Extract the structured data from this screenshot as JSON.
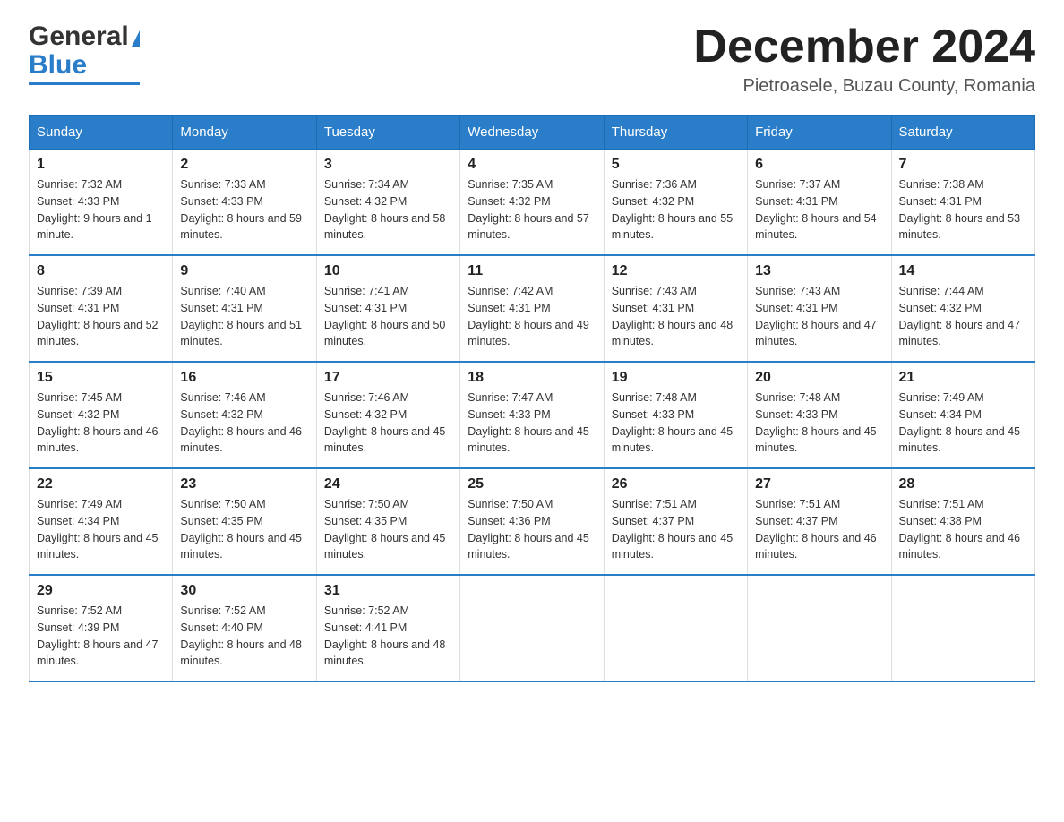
{
  "logo": {
    "general": "General",
    "blue": "Blue",
    "triangle": "▶"
  },
  "header": {
    "title": "December 2024",
    "subtitle": "Pietroasele, Buzau County, Romania"
  },
  "days_of_week": [
    "Sunday",
    "Monday",
    "Tuesday",
    "Wednesday",
    "Thursday",
    "Friday",
    "Saturday"
  ],
  "weeks": [
    [
      {
        "date": "1",
        "sunrise": "7:32 AM",
        "sunset": "4:33 PM",
        "daylight": "9 hours and 1 minute."
      },
      {
        "date": "2",
        "sunrise": "7:33 AM",
        "sunset": "4:33 PM",
        "daylight": "8 hours and 59 minutes."
      },
      {
        "date": "3",
        "sunrise": "7:34 AM",
        "sunset": "4:32 PM",
        "daylight": "8 hours and 58 minutes."
      },
      {
        "date": "4",
        "sunrise": "7:35 AM",
        "sunset": "4:32 PM",
        "daylight": "8 hours and 57 minutes."
      },
      {
        "date": "5",
        "sunrise": "7:36 AM",
        "sunset": "4:32 PM",
        "daylight": "8 hours and 55 minutes."
      },
      {
        "date": "6",
        "sunrise": "7:37 AM",
        "sunset": "4:31 PM",
        "daylight": "8 hours and 54 minutes."
      },
      {
        "date": "7",
        "sunrise": "7:38 AM",
        "sunset": "4:31 PM",
        "daylight": "8 hours and 53 minutes."
      }
    ],
    [
      {
        "date": "8",
        "sunrise": "7:39 AM",
        "sunset": "4:31 PM",
        "daylight": "8 hours and 52 minutes."
      },
      {
        "date": "9",
        "sunrise": "7:40 AM",
        "sunset": "4:31 PM",
        "daylight": "8 hours and 51 minutes."
      },
      {
        "date": "10",
        "sunrise": "7:41 AM",
        "sunset": "4:31 PM",
        "daylight": "8 hours and 50 minutes."
      },
      {
        "date": "11",
        "sunrise": "7:42 AM",
        "sunset": "4:31 PM",
        "daylight": "8 hours and 49 minutes."
      },
      {
        "date": "12",
        "sunrise": "7:43 AM",
        "sunset": "4:31 PM",
        "daylight": "8 hours and 48 minutes."
      },
      {
        "date": "13",
        "sunrise": "7:43 AM",
        "sunset": "4:31 PM",
        "daylight": "8 hours and 47 minutes."
      },
      {
        "date": "14",
        "sunrise": "7:44 AM",
        "sunset": "4:32 PM",
        "daylight": "8 hours and 47 minutes."
      }
    ],
    [
      {
        "date": "15",
        "sunrise": "7:45 AM",
        "sunset": "4:32 PM",
        "daylight": "8 hours and 46 minutes."
      },
      {
        "date": "16",
        "sunrise": "7:46 AM",
        "sunset": "4:32 PM",
        "daylight": "8 hours and 46 minutes."
      },
      {
        "date": "17",
        "sunrise": "7:46 AM",
        "sunset": "4:32 PM",
        "daylight": "8 hours and 45 minutes."
      },
      {
        "date": "18",
        "sunrise": "7:47 AM",
        "sunset": "4:33 PM",
        "daylight": "8 hours and 45 minutes."
      },
      {
        "date": "19",
        "sunrise": "7:48 AM",
        "sunset": "4:33 PM",
        "daylight": "8 hours and 45 minutes."
      },
      {
        "date": "20",
        "sunrise": "7:48 AM",
        "sunset": "4:33 PM",
        "daylight": "8 hours and 45 minutes."
      },
      {
        "date": "21",
        "sunrise": "7:49 AM",
        "sunset": "4:34 PM",
        "daylight": "8 hours and 45 minutes."
      }
    ],
    [
      {
        "date": "22",
        "sunrise": "7:49 AM",
        "sunset": "4:34 PM",
        "daylight": "8 hours and 45 minutes."
      },
      {
        "date": "23",
        "sunrise": "7:50 AM",
        "sunset": "4:35 PM",
        "daylight": "8 hours and 45 minutes."
      },
      {
        "date": "24",
        "sunrise": "7:50 AM",
        "sunset": "4:35 PM",
        "daylight": "8 hours and 45 minutes."
      },
      {
        "date": "25",
        "sunrise": "7:50 AM",
        "sunset": "4:36 PM",
        "daylight": "8 hours and 45 minutes."
      },
      {
        "date": "26",
        "sunrise": "7:51 AM",
        "sunset": "4:37 PM",
        "daylight": "8 hours and 45 minutes."
      },
      {
        "date": "27",
        "sunrise": "7:51 AM",
        "sunset": "4:37 PM",
        "daylight": "8 hours and 46 minutes."
      },
      {
        "date": "28",
        "sunrise": "7:51 AM",
        "sunset": "4:38 PM",
        "daylight": "8 hours and 46 minutes."
      }
    ],
    [
      {
        "date": "29",
        "sunrise": "7:52 AM",
        "sunset": "4:39 PM",
        "daylight": "8 hours and 47 minutes."
      },
      {
        "date": "30",
        "sunrise": "7:52 AM",
        "sunset": "4:40 PM",
        "daylight": "8 hours and 48 minutes."
      },
      {
        "date": "31",
        "sunrise": "7:52 AM",
        "sunset": "4:41 PM",
        "daylight": "8 hours and 48 minutes."
      },
      {
        "date": "",
        "sunrise": "",
        "sunset": "",
        "daylight": ""
      },
      {
        "date": "",
        "sunrise": "",
        "sunset": "",
        "daylight": ""
      },
      {
        "date": "",
        "sunrise": "",
        "sunset": "",
        "daylight": ""
      },
      {
        "date": "",
        "sunrise": "",
        "sunset": "",
        "daylight": ""
      }
    ]
  ],
  "labels": {
    "sunrise": "Sunrise: ",
    "sunset": "Sunset: ",
    "daylight": "Daylight: "
  }
}
